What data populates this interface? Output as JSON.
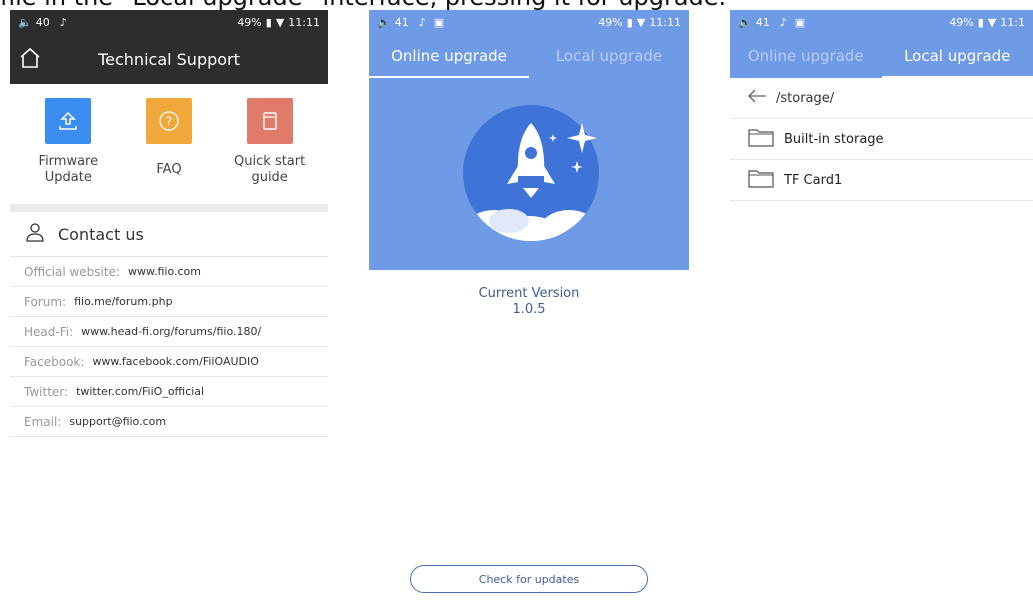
{
  "caption": "file in the “Local upgrade” interface, pressing it for upgrade.",
  "screen1": {
    "status": {
      "volume": "40",
      "battery": "49%",
      "time": "11:11"
    },
    "title": "Technical Support",
    "tiles": [
      {
        "label": "Firmware\nUpdate",
        "icon": "upload-icon",
        "color": "#3b8ef0"
      },
      {
        "label": "FAQ",
        "icon": "question-icon",
        "color": "#f0a83a"
      },
      {
        "label": "Quick start\nguide",
        "icon": "book-icon",
        "color": "#e07b6a"
      }
    ],
    "contact_title": "Contact us",
    "contacts": [
      {
        "key": "Official website:",
        "value": "www.fiio.com"
      },
      {
        "key": "Forum:",
        "value": "fiio.me/forum.php"
      },
      {
        "key": "Head-Fi:",
        "value": "www.head-fi.org/forums/fiio.180/"
      },
      {
        "key": "Facebook:",
        "value": "www.facebook.com/FiiOAUDIO"
      },
      {
        "key": "Twitter:",
        "value": "twitter.com/FiiO_official"
      },
      {
        "key": "Email:",
        "value": "support@fiio.com"
      }
    ]
  },
  "screen2": {
    "status": {
      "volume": "41",
      "battery": "49%",
      "time": "11:11"
    },
    "tab_online": "Online upgrade",
    "tab_local": "Local upgrade",
    "version_label": "Current Version",
    "version_value": "1.0.5",
    "check_button": "Check for updates"
  },
  "screen3": {
    "status": {
      "volume": "41",
      "battery": "49%",
      "time": "11:1"
    },
    "tab_online": "Online upgrade",
    "tab_local": "Local upgrade",
    "path": "/storage/",
    "folders": [
      "Built-in storage",
      "TF Card1"
    ]
  },
  "colors": {
    "dark": "#2d2d2d",
    "accent_blue": "#6f9ae6"
  }
}
